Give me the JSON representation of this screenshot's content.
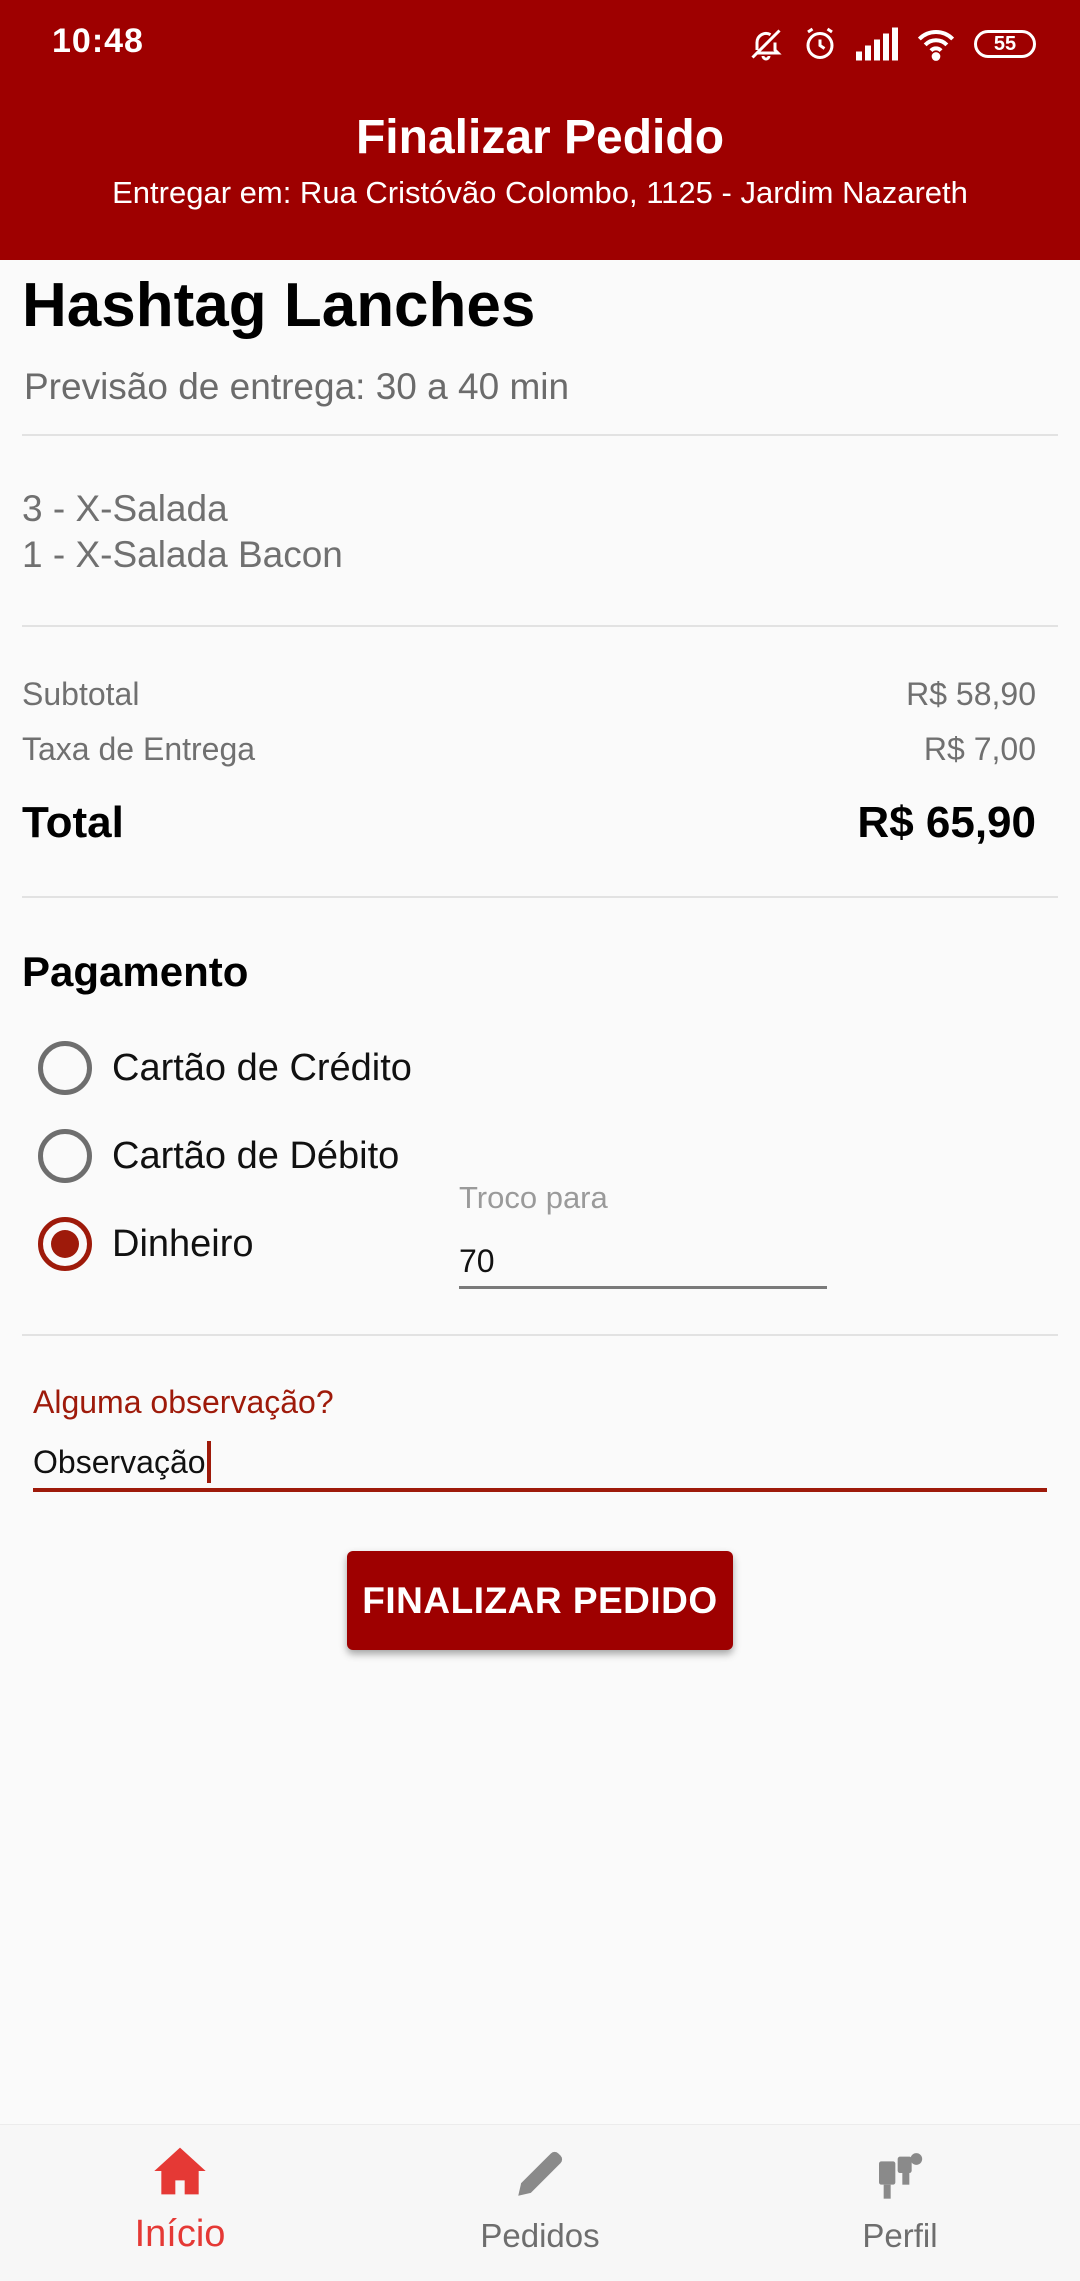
{
  "status_bar": {
    "time": "10:48",
    "battery": "55",
    "icons": [
      "bell-off-icon",
      "alarm-icon",
      "signal-icon",
      "wifi-icon",
      "battery-icon"
    ]
  },
  "header": {
    "title": "Finalizar Pedido",
    "subtitle": "Entregar em: Rua Cristóvão Colombo, 1125 - Jardim Nazareth"
  },
  "store": {
    "name": "Hashtag Lanches",
    "eta": "Previsão de entrega: 30 a 40 min"
  },
  "items": [
    "3 - X-Salada",
    "1 - X-Salada Bacon"
  ],
  "summary": {
    "subtotal_label": "Subtotal",
    "subtotal_value": "R$ 58,90",
    "delivery_label": "Taxa de Entrega",
    "delivery_value": "R$ 7,00",
    "total_label": "Total",
    "total_value": "R$ 65,90"
  },
  "payment": {
    "title": "Pagamento",
    "options": [
      "Cartão de Crédito",
      "Cartão de Débito",
      "Dinheiro"
    ],
    "selected": "Dinheiro",
    "change_label": "Troco para",
    "change_value": "70"
  },
  "observation": {
    "label": "Alguma observação?",
    "value": "Observação"
  },
  "submit_label": "FINALIZAR PEDIDO",
  "bottom_nav": {
    "items": [
      {
        "label": "Início",
        "icon": "home-icon",
        "active": true
      },
      {
        "label": "Pedidos",
        "icon": "pencil-icon",
        "active": false
      },
      {
        "label": "Perfil",
        "icon": "profile-icon",
        "active": false
      }
    ]
  },
  "colors": {
    "primary": "#9e0000",
    "accent": "#9e1a0a",
    "nav_active": "#e53935",
    "nav_inactive": "#8a8a8a"
  }
}
